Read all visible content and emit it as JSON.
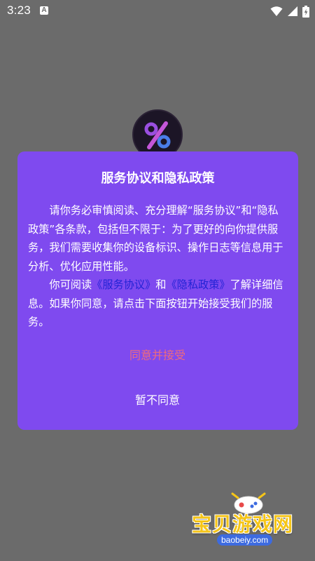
{
  "status_bar": {
    "time": "3:23",
    "notification_badge": "A",
    "icons": [
      "wifi-icon",
      "cellular-signal-icon",
      "battery-icon"
    ]
  },
  "app": {
    "logo_glyph": "%"
  },
  "dialog": {
    "title": "服务协议和隐私政策",
    "paragraph1": "请你务必审慎阅读、充分理解“服务协议”和“隐私政策”各条款，包括但不限于：为了更好的向你提供服务，我们需要收集你的设备标识、操作日志等信息用于分析、优化应用性能。",
    "paragraph2_prefix": "你可阅读",
    "service_agreement_link": "《服务协议》",
    "paragraph2_and": "和",
    "privacy_policy_link": "《隐私政策》",
    "paragraph2_suffix": "了解详细信息。如果你同意，请点击下面按钮开始接受我们的服务。",
    "agree_label": "同意并接受",
    "disagree_label": "暂不同意"
  },
  "watermark": {
    "title": "宝贝游戏网",
    "url": "baobeiy.com"
  },
  "colors": {
    "backdrop": "#6b6b6b",
    "dialog_bg": "#7f4aef",
    "link": "#2323d6",
    "agree_text": "#ee6b7d",
    "text": "#ffffff"
  }
}
